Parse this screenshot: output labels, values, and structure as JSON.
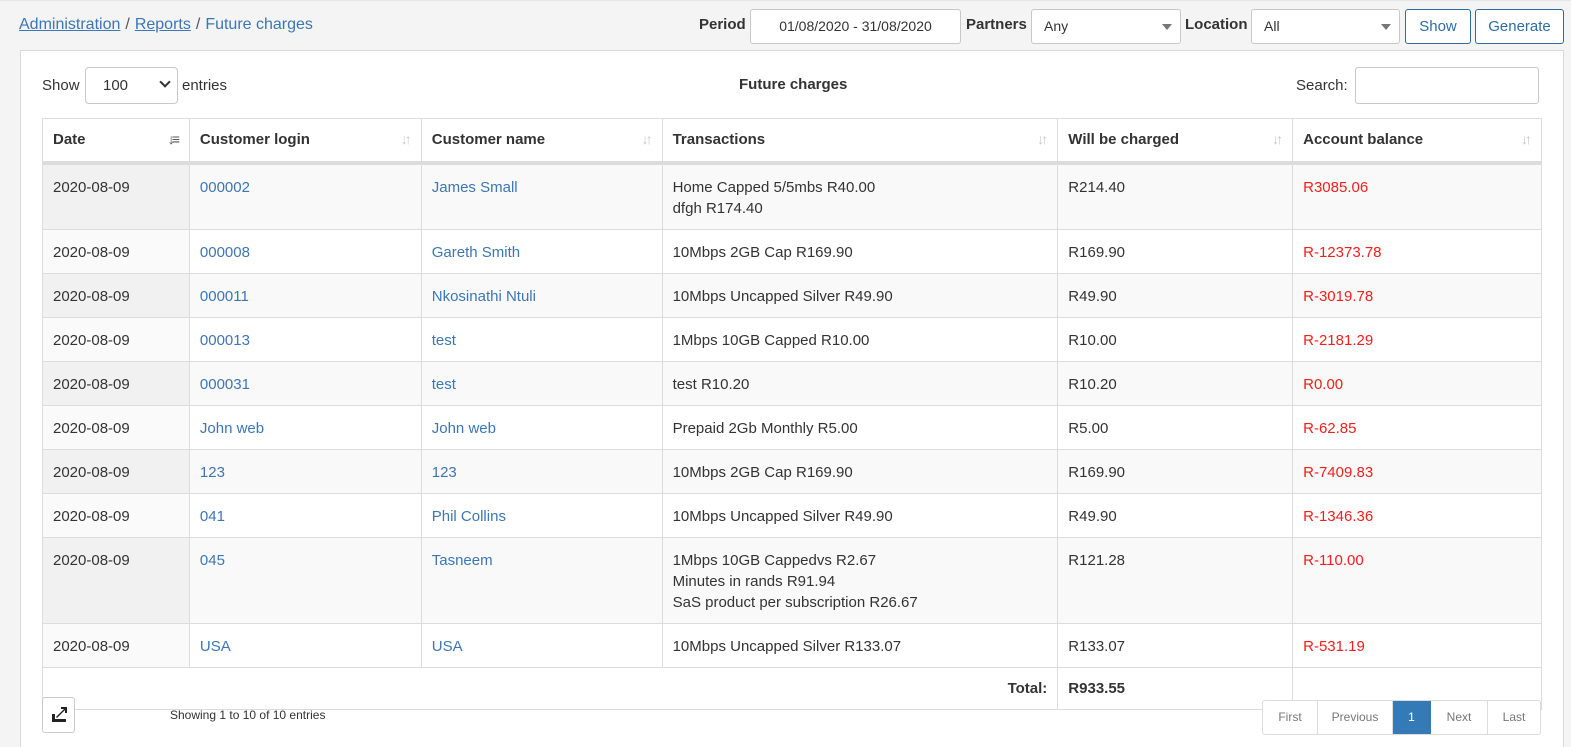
{
  "breadcrumb": {
    "administration": "Administration",
    "reports": "Reports",
    "sep1": "/",
    "sep2": "/",
    "current": "Future charges"
  },
  "filters": {
    "period_label": "Period",
    "period_value": "01/08/2020 - 31/08/2020",
    "partners_label": "Partners",
    "partners_value": "Any",
    "location_label": "Location",
    "location_value": "All",
    "show_button": "Show",
    "generate_button": "Generate"
  },
  "table_controls": {
    "show_label": "Show",
    "entries_value": "100",
    "entries_label": "entries",
    "title": "Future charges",
    "search_label": "Search:",
    "search_value": ""
  },
  "columns": {
    "date": "Date",
    "customer_login": "Customer login",
    "customer_name": "Customer name",
    "transactions": "Transactions",
    "will_be_charged": "Will be charged",
    "account_balance": "Account balance"
  },
  "rows": [
    {
      "date": "2020-08-09",
      "login": "000002",
      "name": "James Small",
      "transactions": [
        "Home Capped 5/5mbs R40.00",
        "dfgh R174.40"
      ],
      "charged": "R214.40",
      "balance": "R3085.06"
    },
    {
      "date": "2020-08-09",
      "login": "000008",
      "name": "Gareth Smith",
      "transactions": [
        "10Mbps 2GB Cap R169.90"
      ],
      "charged": "R169.90",
      "balance": "R-12373.78"
    },
    {
      "date": "2020-08-09",
      "login": "000011",
      "name": "Nkosinathi Ntuli",
      "transactions": [
        "10Mbps Uncapped Silver R49.90"
      ],
      "charged": "R49.90",
      "balance": "R-3019.78"
    },
    {
      "date": "2020-08-09",
      "login": "000013",
      "name": "test",
      "transactions": [
        "1Mbps 10GB Capped R10.00"
      ],
      "charged": "R10.00",
      "balance": "R-2181.29"
    },
    {
      "date": "2020-08-09",
      "login": "000031",
      "name": "test",
      "transactions": [
        "test R10.20"
      ],
      "charged": "R10.20",
      "balance": "R0.00"
    },
    {
      "date": "2020-08-09",
      "login": "John web",
      "name": "John web",
      "transactions": [
        "Prepaid 2Gb Monthly R5.00"
      ],
      "charged": "R5.00",
      "balance": "R-62.85"
    },
    {
      "date": "2020-08-09",
      "login": "123",
      "name": "123",
      "transactions": [
        "10Mbps 2GB Cap R169.90"
      ],
      "charged": "R169.90",
      "balance": "R-7409.83"
    },
    {
      "date": "2020-08-09",
      "login": "041",
      "name": "Phil Collins",
      "transactions": [
        "10Mbps Uncapped Silver R49.90"
      ],
      "charged": "R49.90",
      "balance": "R-1346.36"
    },
    {
      "date": "2020-08-09",
      "login": "045",
      "name": "Tasneem",
      "transactions": [
        "1Mbps 10GB Cappedvs R2.67",
        "Minutes in rands R91.94",
        "SaS product per subscription R26.67"
      ],
      "charged": "R121.28",
      "balance": "R-110.00"
    },
    {
      "date": "2020-08-09",
      "login": "USA",
      "name": "USA",
      "transactions": [
        "10Mbps Uncapped Silver R133.07"
      ],
      "charged": "R133.07",
      "balance": "R-531.19"
    }
  ],
  "total": {
    "label": "Total:",
    "value": "R933.55"
  },
  "footer": {
    "info": "Showing 1 to 10 of 10 entries",
    "pager": {
      "first": "First",
      "previous": "Previous",
      "current": "1",
      "next": "Next",
      "last": "Last"
    }
  },
  "icons": {
    "sort": "sort-arrows-icon",
    "sort_active": "sort-amount-down-icon",
    "export": "export-icon",
    "dropdown": "caret-down-icon"
  },
  "colors": {
    "link": "#3c76b4",
    "negative_balance": "#f21d1d",
    "primary": "#337ab7"
  }
}
